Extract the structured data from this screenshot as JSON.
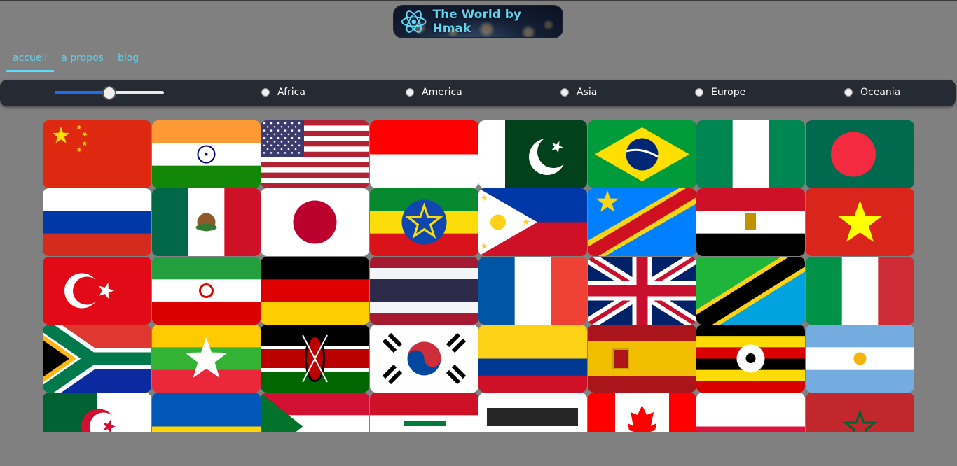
{
  "app": {
    "title": "The World by Hmak",
    "logo_icon": "react-atom-icon"
  },
  "nav": {
    "items": [
      {
        "label": "accueil",
        "active": true
      },
      {
        "label": "a propos",
        "active": false
      },
      {
        "label": "blog",
        "active": false
      }
    ]
  },
  "filter": {
    "slider": {
      "value_fraction": 0.5,
      "accent": "#1e6ef0"
    },
    "regions": [
      {
        "label": "Africa",
        "selected": false
      },
      {
        "label": "America",
        "selected": false
      },
      {
        "label": "Asia",
        "selected": false
      },
      {
        "label": "Europe",
        "selected": false
      },
      {
        "label": "Oceania",
        "selected": false
      }
    ]
  },
  "flags": [
    "china",
    "india",
    "united-states",
    "indonesia",
    "pakistan",
    "brazil",
    "nigeria",
    "bangladesh",
    "russia",
    "mexico",
    "japan",
    "ethiopia",
    "philippines",
    "dr-congo",
    "egypt",
    "vietnam",
    "turkey",
    "iran",
    "germany",
    "thailand",
    "france",
    "united-kingdom",
    "tanzania",
    "italy",
    "south-africa",
    "myanmar",
    "kenya",
    "south-korea",
    "colombia",
    "spain",
    "uganda",
    "argentina",
    "algeria",
    "ukraine",
    "sudan",
    "iraq",
    "afghanistan",
    "canada",
    "poland",
    "morocco"
  ],
  "colors": {
    "background": "#808080",
    "toolbar": "#262a33",
    "nav_text": "#5fd0ec",
    "nav_active_underline": "#61dafb"
  }
}
